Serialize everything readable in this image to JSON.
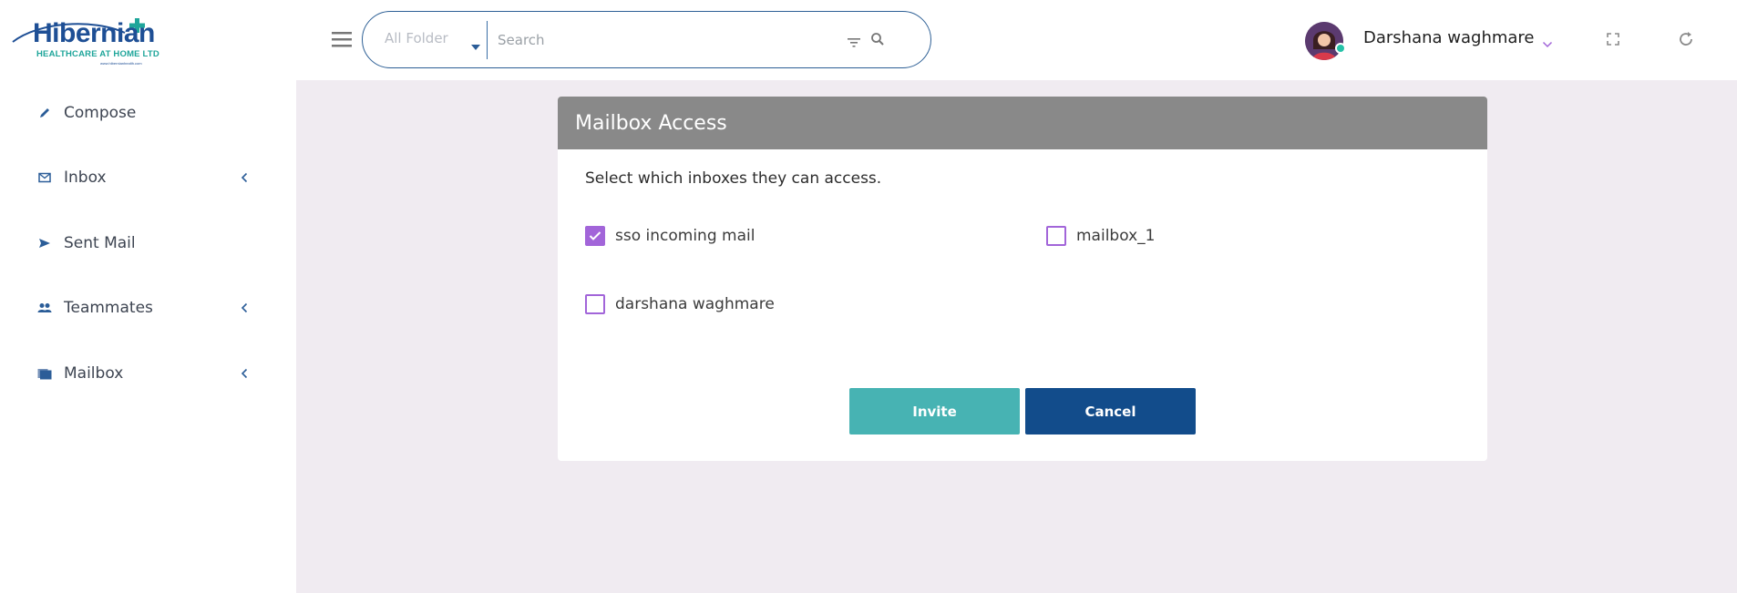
{
  "brand": {
    "name": "Hibernian",
    "tagline": "HEALTHCARE AT HOME LTD",
    "url": "www.hibernianhealth.com"
  },
  "sidebar": {
    "items": [
      {
        "label": "Compose",
        "icon": "pencil-icon",
        "has_chevron": false
      },
      {
        "label": "Inbox",
        "icon": "envelope-icon",
        "has_chevron": true
      },
      {
        "label": "Sent Mail",
        "icon": "send-icon",
        "has_chevron": false
      },
      {
        "label": "Teammates",
        "icon": "people-icon",
        "has_chevron": true
      },
      {
        "label": "Mailbox",
        "icon": "folder-icon",
        "has_chevron": true
      }
    ]
  },
  "header": {
    "folder_select": "All Folder",
    "search_placeholder": "Search",
    "user_name": "Darshana waghmare"
  },
  "modal": {
    "title": "Mailbox Access",
    "description": "Select which inboxes they can access.",
    "options": [
      {
        "label": "sso incoming mail",
        "checked": true
      },
      {
        "label": "mailbox_1",
        "checked": false
      },
      {
        "label": "darshana waghmare",
        "checked": false
      }
    ],
    "invite_label": "Invite",
    "cancel_label": "Cancel"
  },
  "colors": {
    "brand_blue": "#1e4f95",
    "brand_teal": "#1ea59a",
    "checkbox_purple": "#a265d9",
    "invite_teal": "#47b3b3",
    "cancel_navy": "#124c8b",
    "main_bg": "#f0ebf1",
    "modal_header": "#898989",
    "online_status": "#25c2a8"
  }
}
